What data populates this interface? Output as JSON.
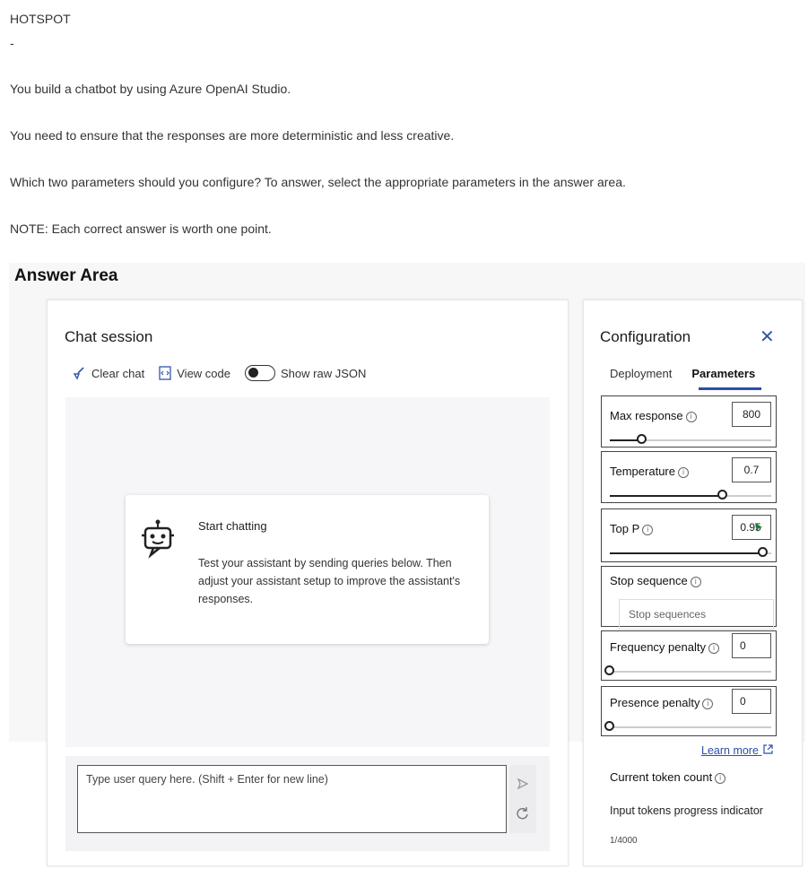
{
  "question": {
    "header": "HOTSPOT",
    "dash": "-",
    "line1": "You build a chatbot by using Azure OpenAI Studio.",
    "line2": "You need to ensure that the responses are more deterministic and less creative.",
    "line3": "Which two parameters should you configure? To answer, select the appropriate parameters in the answer area.",
    "note": "NOTE: Each correct answer is worth one point."
  },
  "answer_area": {
    "title": "Answer Area"
  },
  "chat": {
    "title": "Chat session",
    "clear_chat": "Clear chat",
    "view_code": "View code",
    "show_raw_json": "Show raw JSON",
    "start_title": "Start chatting",
    "start_text": "Test your assistant by sending queries below. Then adjust your assistant setup to improve the assistant's responses.",
    "input_placeholder": "Type user query here. (Shift + Enter for new line)"
  },
  "config": {
    "title": "Configuration",
    "tabs": [
      "Deployment",
      "Parameters"
    ],
    "active_tab": "Parameters",
    "params": {
      "max_response": {
        "label": "Max response",
        "value": "800",
        "fill_fraction": 0.2
      },
      "temperature": {
        "label": "Temperature",
        "value": "0.7",
        "fill_fraction": 0.7
      },
      "top_p": {
        "label": "Top P",
        "value": "0.95",
        "fill_fraction": 0.95
      },
      "stop_sequence": {
        "label": "Stop sequence",
        "placeholder": "Stop sequences"
      },
      "frequency_penalty": {
        "label": "Frequency penalty",
        "value": "0",
        "fill_fraction": 0
      },
      "presence_penalty": {
        "label": "Presence penalty",
        "value": "0",
        "fill_fraction": 0
      }
    },
    "learn_more": "Learn more",
    "token_title": "Current token count",
    "token_indicator": "Input tokens progress indicator",
    "token_count": "1/4000"
  },
  "colors": {
    "accent": "#2b4fa8",
    "cursor_green": "#1e7b34"
  }
}
